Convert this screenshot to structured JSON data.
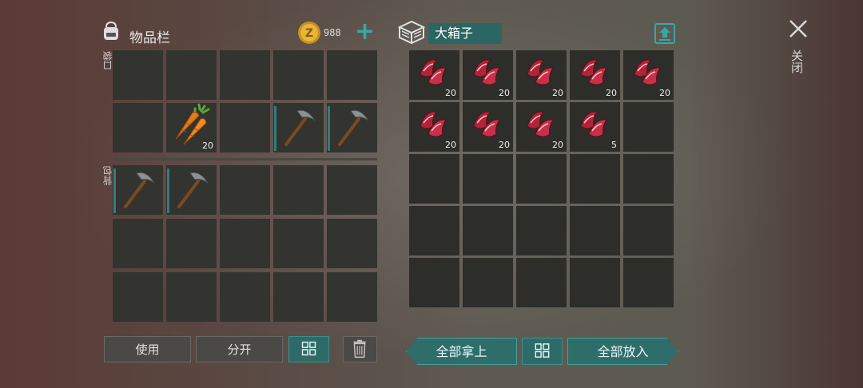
{
  "inventory": {
    "title": "物品栏",
    "coins": "988",
    "pocket_label": "口袋",
    "backpack_label": "背包"
  },
  "container": {
    "name": "大箱子"
  },
  "close_label": "关闭",
  "items": {
    "carrot_qty": "20",
    "meat_qty_full": "20",
    "meat_qty_last": "5"
  },
  "buttons": {
    "use": "使用",
    "split": "分开",
    "take_all": "全部拿上",
    "put_all": "全部放入"
  },
  "colors": {
    "accent": "#2e6d6a",
    "slot": "#33332f"
  }
}
